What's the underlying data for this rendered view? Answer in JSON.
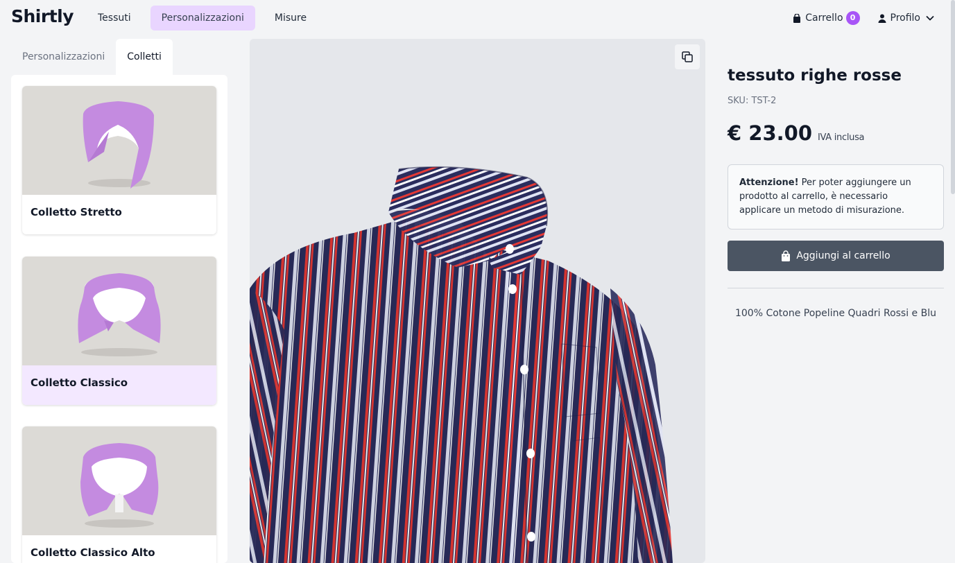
{
  "header": {
    "logo": "Shirtly",
    "nav": [
      {
        "label": "Tessuti"
      },
      {
        "label": "Personalizzazioni"
      },
      {
        "label": "Misure"
      }
    ],
    "cart_label": "Carrello",
    "cart_count": "0",
    "profile_label": "Profilo"
  },
  "left": {
    "tabs": [
      {
        "label": "Personalizzazioni"
      },
      {
        "label": "Colletti"
      }
    ],
    "collars": [
      {
        "label": "Colletto Stretto"
      },
      {
        "label": "Colletto Classico"
      },
      {
        "label": "Colletto Classico Alto"
      }
    ]
  },
  "product": {
    "title": "tessuto righe rosse",
    "sku": "SKU: TST-2",
    "price": "€ 23.00",
    "vat": "IVA inclusa",
    "notice_strong": "Attenzione!",
    "notice_text": " Per poter aggiungere un prodotto al carrello, è necessario applicare un metodo di misurazione.",
    "add_to_cart": "Aggiungi al carrello",
    "description": "100% Cotone Popeline Quadri Rossi e Blu"
  },
  "colors": {
    "accent": "#a855f7",
    "nav_active": "#e9d5ff",
    "collar": "#c084fc",
    "shirt_navy": "#2b2d5e",
    "stripe_red": "#e53935",
    "button_dark": "#4b5563"
  }
}
